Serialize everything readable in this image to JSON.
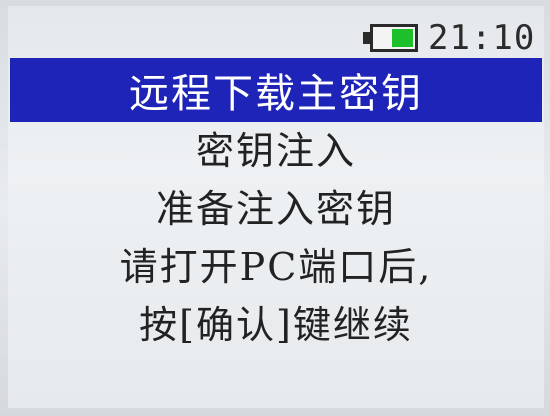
{
  "status_bar": {
    "battery_icon": "battery-icon",
    "battery_level": 0.5,
    "battery_color": "#1dbf2a",
    "time": "21:10"
  },
  "title": "远程下载主密钥",
  "title_bar_color": "#1f24b8",
  "message_lines": [
    "密钥注入",
    "准备注入密钥",
    "请打开PC端口后,",
    "按[确认]键继续"
  ]
}
